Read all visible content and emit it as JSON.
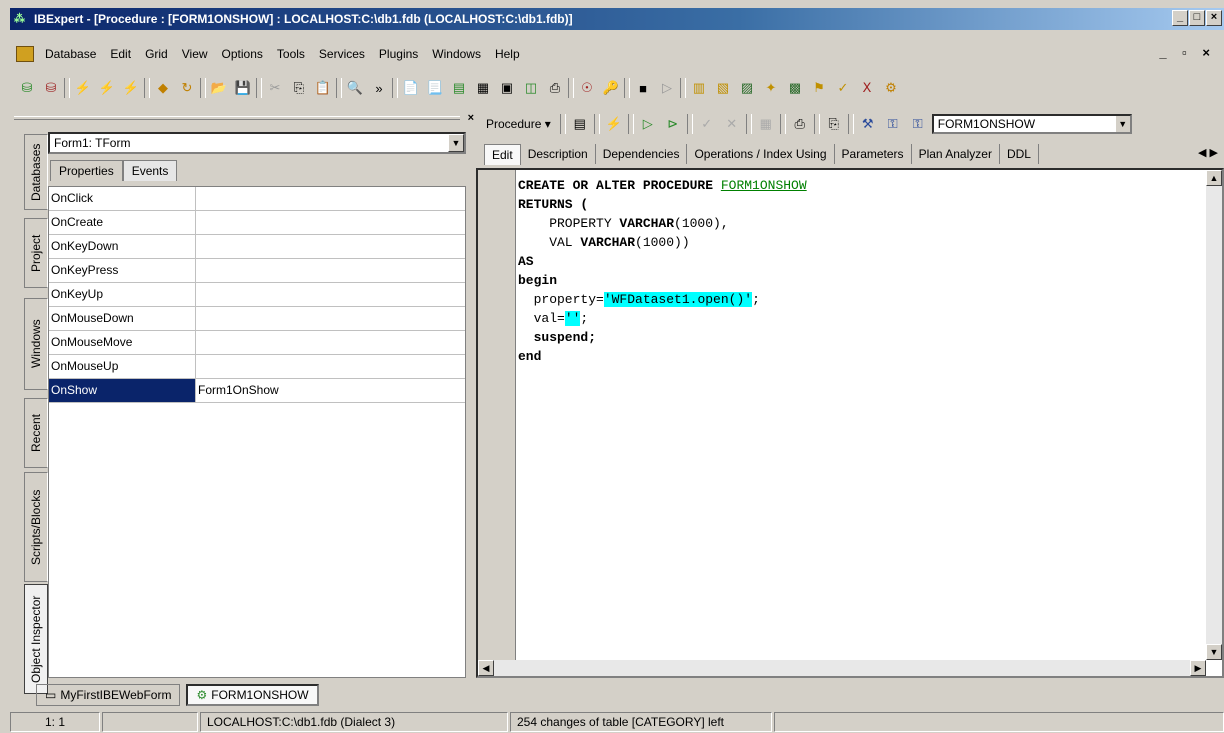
{
  "window": {
    "title": "IBExpert - [Procedure : [FORM1ONSHOW] : LOCALHOST:C:\\db1.fdb (LOCALHOST:C:\\db1.fdb)]"
  },
  "menu": [
    "Database",
    "Edit",
    "Grid",
    "View",
    "Options",
    "Tools",
    "Services",
    "Plugins",
    "Windows",
    "Help"
  ],
  "left_panel": {
    "vertical_tabs": [
      "Databases",
      "Project",
      "Windows",
      "Recent",
      "Scripts/Blocks",
      "Object Inspector"
    ],
    "active_vertical_tab": "Object Inspector",
    "component_select": "Form1: TForm",
    "tabs": [
      "Properties",
      "Events"
    ],
    "active_tab": "Events",
    "events": [
      {
        "name": "OnClick",
        "value": ""
      },
      {
        "name": "OnCreate",
        "value": ""
      },
      {
        "name": "OnKeyDown",
        "value": ""
      },
      {
        "name": "OnKeyPress",
        "value": ""
      },
      {
        "name": "OnKeyUp",
        "value": ""
      },
      {
        "name": "OnMouseDown",
        "value": ""
      },
      {
        "name": "OnMouseMove",
        "value": ""
      },
      {
        "name": "OnMouseUp",
        "value": ""
      },
      {
        "name": "OnShow",
        "value": "Form1OnShow",
        "selected": true
      }
    ]
  },
  "procedure": {
    "toolbar_label": "Procedure",
    "name": "FORM1ONSHOW",
    "tabs": [
      "Edit",
      "Description",
      "Dependencies",
      "Operations / Index Using",
      "Parameters",
      "Plan Analyzer",
      "DDL"
    ],
    "active_tab": "Edit",
    "code": {
      "l1_kw": "CREATE OR ALTER PROCEDURE ",
      "l1_name": "FORM1ONSHOW",
      "l2": "RETURNS (",
      "l3_a": "    PROPERTY ",
      "l3_type": "VARCHAR",
      "l3_b": "(1000),",
      "l4_a": "    VAL ",
      "l4_type": "VARCHAR",
      "l4_b": "(1000))",
      "l5": "AS",
      "l6": "begin",
      "l7_a": "  property=",
      "l7_str": "'WFDataset1.open()'",
      "l7_b": ";",
      "l8_a": "  val=",
      "l8_str": "''",
      "l8_b": ";",
      "l9": "  suspend;",
      "l10": "end"
    }
  },
  "bottom_tabs": [
    "MyFirstIBEWebForm",
    "FORM1ONSHOW"
  ],
  "status": {
    "pos": "1:  1",
    "db": "LOCALHOST:C:\\db1.fdb (Dialect 3)",
    "msg": "254 changes of table [CATEGORY] left"
  }
}
